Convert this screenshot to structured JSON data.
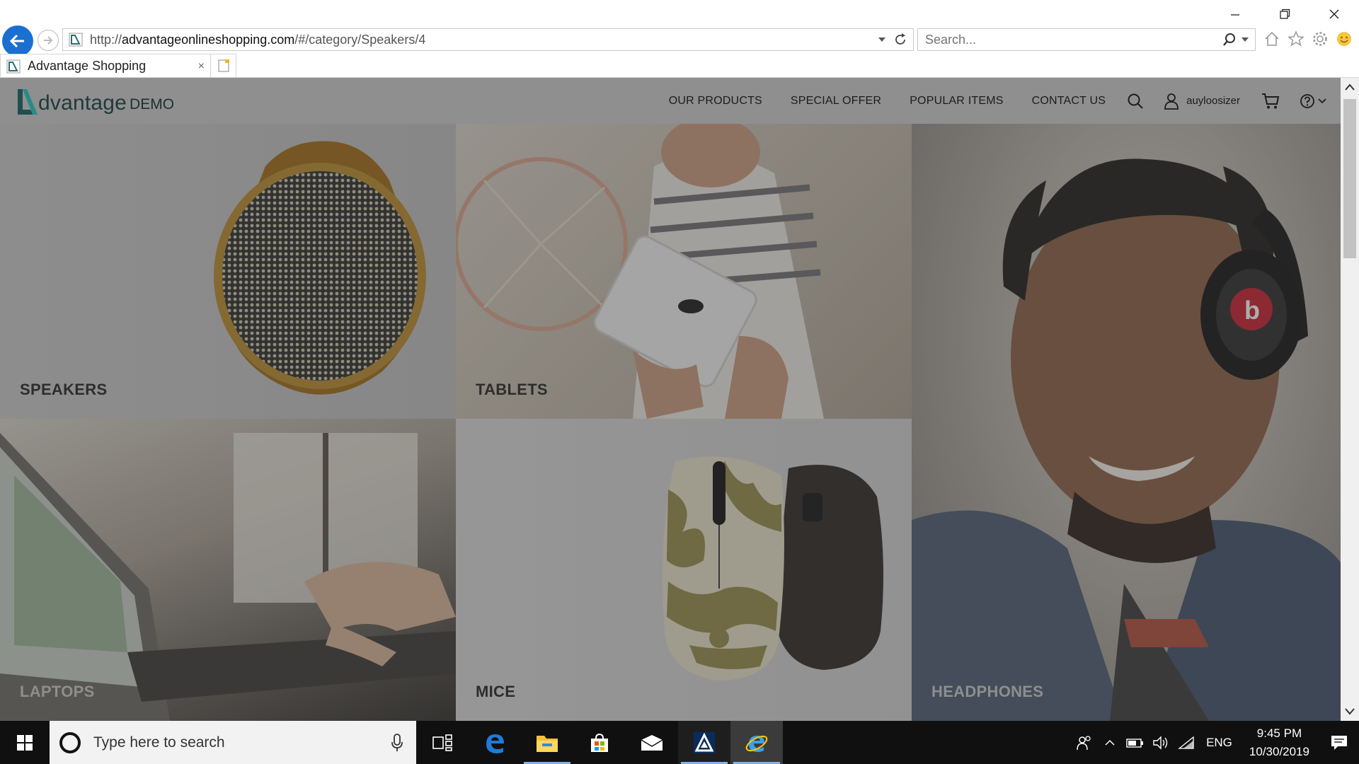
{
  "browser": {
    "address_prefix": "http://",
    "address_host": "advantageonlineshopping.com",
    "address_path": "/#/category/Speakers/4",
    "search_placeholder": "Search...",
    "tab_title": "Advantage Shopping",
    "tab_close": "×"
  },
  "site": {
    "logo_text": "dvantage",
    "logo_demo": "DEMO",
    "nav": [
      "OUR PRODUCTS",
      "SPECIAL OFFER",
      "POPULAR ITEMS",
      "CONTACT US"
    ],
    "username": "auyloosizer"
  },
  "categories": {
    "speakers": "SPEAKERS",
    "tablets": "TABLETS",
    "headphones": "HEADPHONES",
    "laptops": "LAPTOPS",
    "mice": "MICE"
  },
  "taskbar": {
    "search_placeholder": "Type here to search",
    "language": "ENG",
    "time": "9:45 PM",
    "date": "10/30/2019"
  },
  "colors": {
    "accent_blue": "#1a6fd1",
    "logo_teal": "#21393b",
    "overlay": "rgba(60,60,60,0.42)"
  },
  "icons": [
    "back-arrow-icon",
    "forward-arrow-icon",
    "refresh-icon",
    "search-icon",
    "home-icon",
    "favorites-star-icon",
    "settings-gear-icon",
    "smiley-icon",
    "user-icon",
    "cart-icon",
    "help-icon",
    "windows-start-icon",
    "microphone-icon",
    "task-view-icon",
    "edge-icon",
    "file-explorer-icon",
    "store-icon",
    "mail-icon",
    "app-icon",
    "internet-explorer-icon"
  ]
}
